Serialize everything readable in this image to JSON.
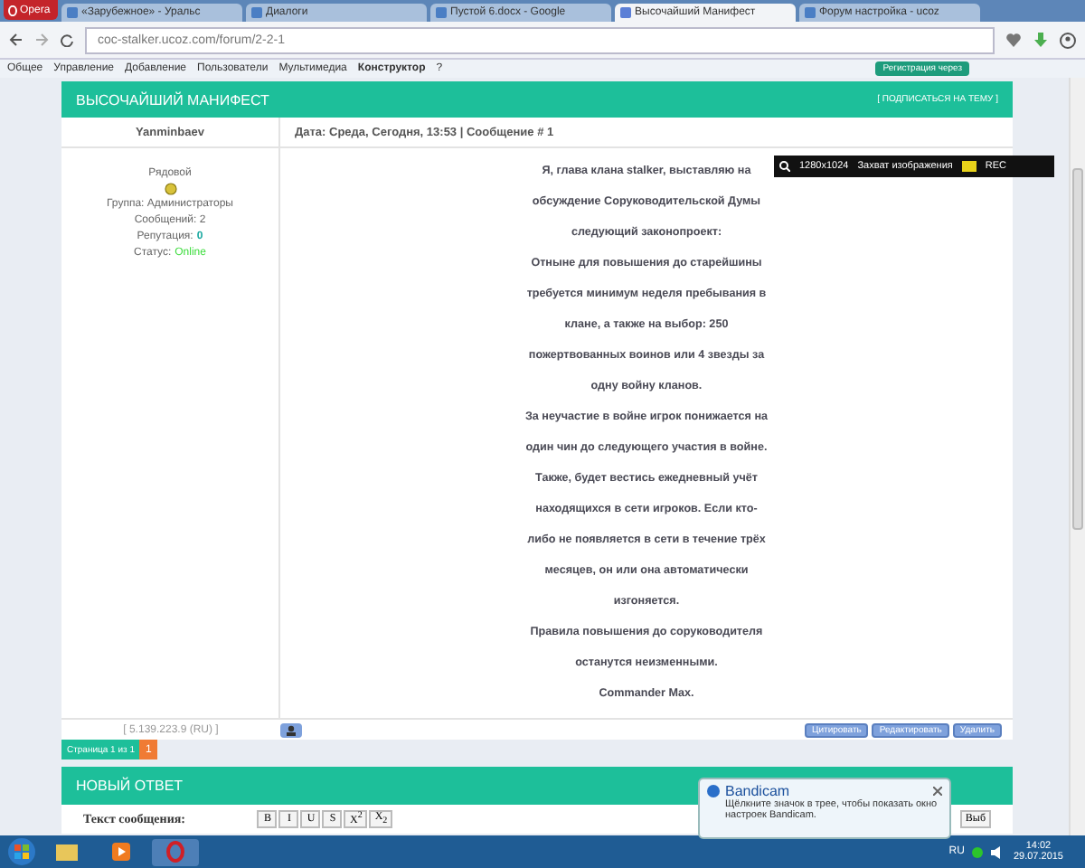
{
  "browser": {
    "menu": "Opera",
    "tabs": [
      {
        "title": "«Зарубежное» - Уральс",
        "selected": false
      },
      {
        "title": "Диалоги",
        "selected": false
      },
      {
        "title": "Пустой 6.docx - Google",
        "selected": false
      },
      {
        "title": "Высочайший Манифест",
        "selected": true
      },
      {
        "title": "Форум настройка - ucoz",
        "selected": false
      }
    ],
    "address": "coc-stalker.ucoz.com/forum/2-2-1"
  },
  "ucoz_panel": {
    "items": [
      {
        "label": "Общее",
        "selected": false
      },
      {
        "label": "Управление",
        "selected": false
      },
      {
        "label": "Добавление",
        "selected": false
      },
      {
        "label": "Пользователи",
        "selected": false
      },
      {
        "label": "Мультимедиа",
        "selected": false
      },
      {
        "label": "Конструктор",
        "selected": true
      },
      {
        "label": "?",
        "selected": false
      }
    ],
    "register": "Регистрация через"
  },
  "topic": {
    "title": "ВЫСОЧАЙШИЙ МАНИФЕСТ",
    "subscribe": "[ ПОДПИСАТЬСЯ НА ТЕМУ ]"
  },
  "post": {
    "author": "Yanminbaev",
    "meta": "Дата: Среда, Сегодня, 13:53 | Сообщение # 1",
    "rank": "Рядовой",
    "group": "Группа: Администраторы",
    "messages": "Сообщений: 2",
    "reputation_label": "Репутация:",
    "reputation_value": "0",
    "status_label": "Статус:",
    "status_value": "Online",
    "paragraphs": [
      "Я, глава клана stalker, выставляю на обсуждение Соруководительской Думы следующий законопроект:",
      "Отныне для повышения до старейшины требуется минимум неделя пребывания в клане, а также на выбор: 250 пожертвованных воинов или 4 звезды за одну войну кланов.",
      "За неучастие в войне игрок понижается на один чин до следующего участия в войне.",
      "Также, будет вестись ежедневный учёт находящихся в сети игроков. Если кто-либо не появляется в сети в течение трёх месяцев, он или она автоматически изгоняется.",
      "Правила повышения до соруководителя останутся неизменными.",
      "Commander Max."
    ],
    "ip": "[ 5.139.223.9 (RU) ]",
    "actions": [
      "Цитировать",
      "Редактировать",
      "Удалить"
    ]
  },
  "pagination": {
    "label": "Страница 1 из 1",
    "pages": [
      {
        "label": "1",
        "selected": true
      }
    ]
  },
  "reply": {
    "title": "НОВЫЙ ОТВЕТ",
    "label": "Текст сообщения:",
    "toolbar": [
      "B",
      "I",
      "U",
      "S",
      "X$^{2}$",
      "X$_{2}$"
    ],
    "select": "Выб"
  },
  "capture_bar": {
    "resolution": "1280x1024",
    "mode": "Захват изображения",
    "rec": "REC"
  },
  "notification": {
    "title": "Bandicam",
    "text": "Щёлкните значок в трее, чтобы показать окно настроек Bandicam."
  },
  "taskbar": {
    "language": "RU",
    "time": "14:02",
    "date": "29.07.2015"
  }
}
